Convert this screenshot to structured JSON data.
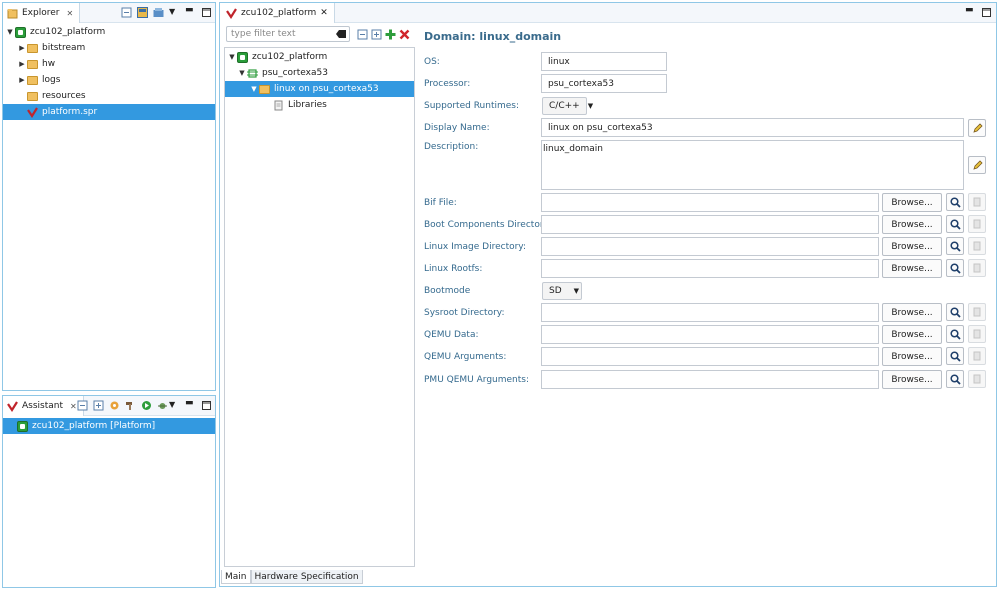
{
  "explorer": {
    "tab_label": "Explorer",
    "tree": [
      {
        "label": "zcu102_platform",
        "icon": "platform-icon",
        "expanded": true,
        "level": 0
      },
      {
        "label": "bitstream",
        "icon": "folder-icon",
        "level": 1
      },
      {
        "label": "hw",
        "icon": "folder-icon",
        "level": 1
      },
      {
        "label": "logs",
        "icon": "folder-icon",
        "level": 1
      },
      {
        "label": "resources",
        "icon": "folder-icon",
        "level": 1
      },
      {
        "label": "platform.spr",
        "icon": "spr-file-icon",
        "level": 1,
        "selected": true
      }
    ]
  },
  "assistant": {
    "tab_label": "Assistant",
    "item": "zcu102_platform [Platform]"
  },
  "editor": {
    "tab_label": "zcu102_platform",
    "filter_placeholder": "type filter text",
    "tree": [
      {
        "label": "zcu102_platform"
      },
      {
        "label": "psu_cortexa53"
      },
      {
        "label": "linux on psu_cortexa53"
      },
      {
        "label": "Libraries"
      }
    ],
    "title": "Domain: linux_domain",
    "labels": {
      "os": "OS:",
      "processor": "Processor:",
      "runtimes": "Supported Runtimes:",
      "display_name": "Display Name:",
      "description": "Description:",
      "bif": "Bif File:",
      "boot_components": "Boot Components Directory:",
      "linux_image": "Linux Image Directory:",
      "linux_rootfs": "Linux Rootfs:",
      "bootmode": "Bootmode",
      "sysroot": "Sysroot Directory:",
      "qemu_data": "QEMU Data:",
      "qemu_args": "QEMU Arguments:",
      "pmu_qemu_args": "PMU QEMU Arguments:"
    },
    "values": {
      "os": "linux",
      "processor": "psu_cortexa53",
      "runtimes": "C/C++",
      "display_name": "linux on psu_cortexa53",
      "description": "linux_domain",
      "bootmode": "SD"
    },
    "browse_label": "Browse...",
    "bottom_tabs": [
      "Main",
      "Hardware Specification"
    ]
  },
  "colors": {
    "selection": "#3399e0",
    "view_border": "#8fc7e6",
    "label_text": "#356a8e"
  }
}
